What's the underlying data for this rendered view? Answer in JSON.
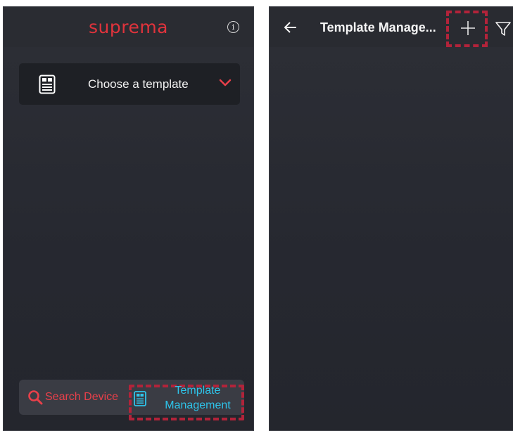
{
  "left_screen": {
    "header": {
      "brand_logo": "suprema",
      "info_icon": "info-icon"
    },
    "template_selector": {
      "icon": "template-document-icon",
      "label": "Choose a template",
      "chevron_icon": "chevron-down-icon"
    },
    "bottom_nav": {
      "search_device": {
        "icon": "search-icon",
        "label": "Search Device"
      },
      "template_management": {
        "icon": "template-document-icon",
        "label_line1": "Template",
        "label_line2": "Management"
      }
    }
  },
  "right_screen": {
    "header": {
      "back_icon": "arrow-left-icon",
      "title": "Template Manage...",
      "add_icon": "plus-icon",
      "filter_icon": "filter-icon"
    }
  },
  "colors": {
    "brand_red": "#e0333c",
    "accent_cyan": "#2ec4ea",
    "highlight_dash": "#b2233a",
    "background": "#2b2d33"
  }
}
